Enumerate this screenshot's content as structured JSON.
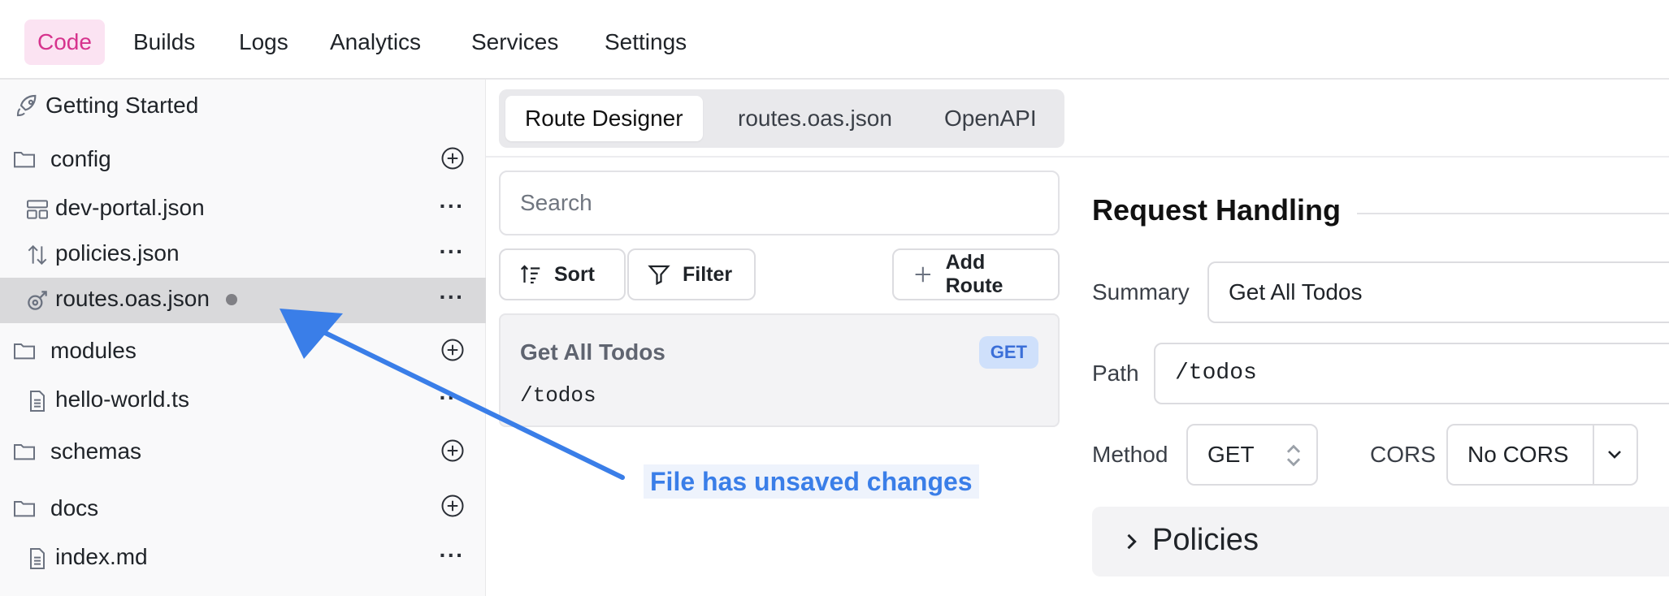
{
  "topnav": {
    "items": [
      "Code",
      "Builds",
      "Logs",
      "Analytics",
      "Services",
      "Settings"
    ],
    "active": "Code"
  },
  "sidebar": {
    "getting_started": "Getting Started",
    "items": [
      {
        "type": "folder",
        "label": "config"
      },
      {
        "type": "file",
        "label": "dev-portal.json",
        "icon": "layout-icon"
      },
      {
        "type": "file",
        "label": "policies.json",
        "icon": "sort-arrows-icon"
      },
      {
        "type": "file",
        "label": "routes.oas.json",
        "icon": "route-icon",
        "selected": true,
        "unsaved": true
      },
      {
        "type": "folder",
        "label": "modules"
      },
      {
        "type": "file",
        "label": "hello-world.ts",
        "icon": "file-icon"
      },
      {
        "type": "folder",
        "label": "schemas"
      },
      {
        "type": "folder",
        "label": "docs"
      },
      {
        "type": "file",
        "label": "index.md",
        "icon": "file-icon"
      }
    ]
  },
  "tabs": [
    "Route Designer",
    "routes.oas.json",
    "OpenAPI"
  ],
  "routes": {
    "search_placeholder": "Search",
    "sort_label": "Sort",
    "filter_label": "Filter",
    "add_label": "Add Route",
    "items": [
      {
        "name": "Get All Todos",
        "method": "GET",
        "path": "/todos"
      }
    ]
  },
  "callout": "File has unsaved changes",
  "request": {
    "title": "Request Handling",
    "summary_label": "Summary",
    "summary_value": "Get All Todos",
    "path_label": "Path",
    "path_value": "/todos",
    "method_label": "Method",
    "method_value": "GET",
    "cors_label": "CORS",
    "cors_value": "No CORS",
    "policies_label": "Policies"
  },
  "colors": {
    "accent_pink": "#d6338d",
    "callout_blue": "#3a7ee8",
    "badge_blue": "#3b6fd8"
  }
}
